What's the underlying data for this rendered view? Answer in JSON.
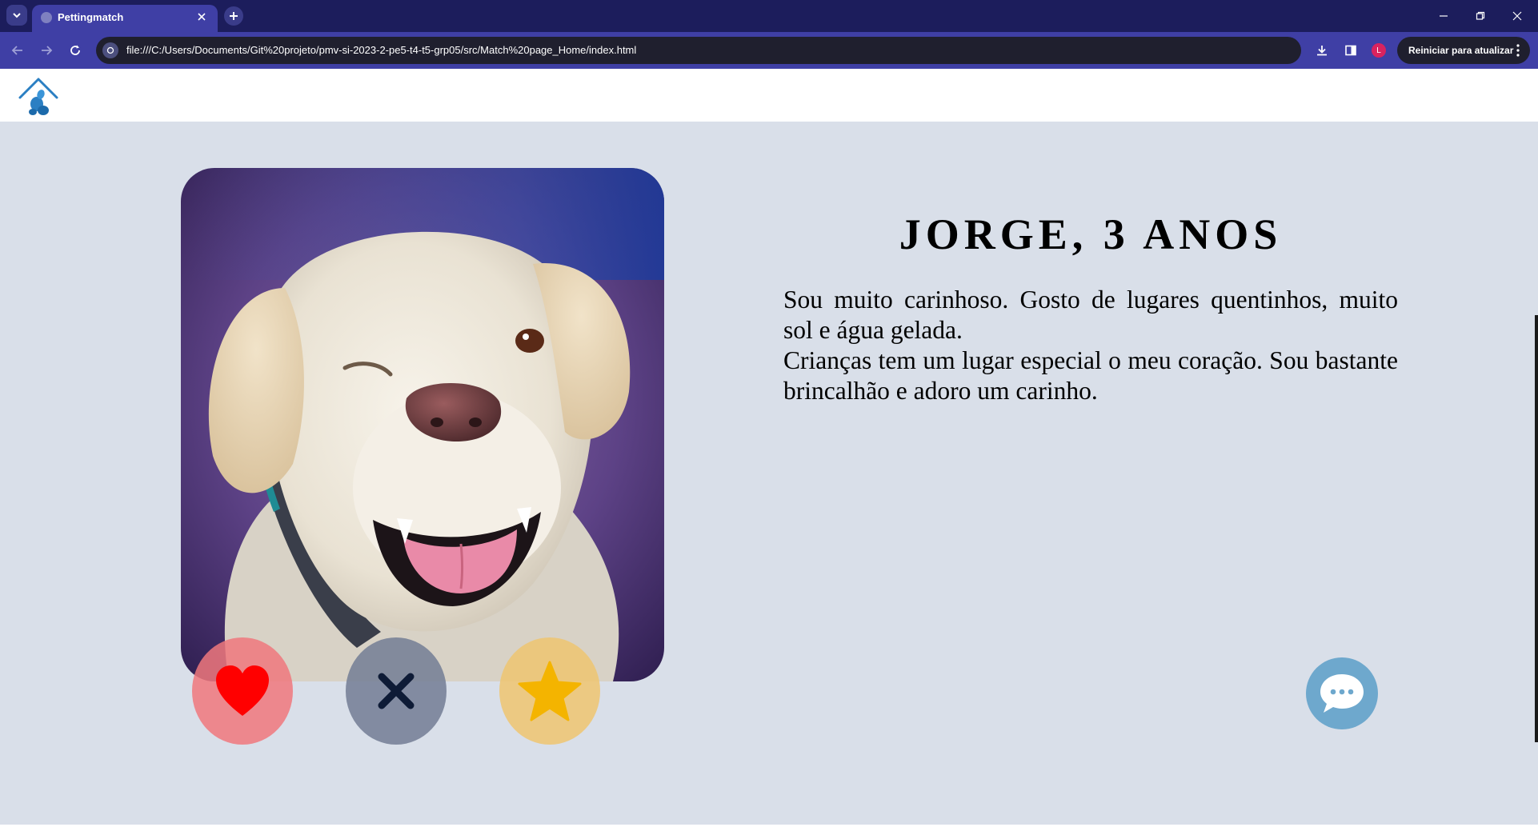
{
  "browser": {
    "tab_title": "Pettingmatch",
    "url": "file:///C:/Users/Documents/Git%20projeto/pmv-si-2023-2-pe5-t4-t5-grp05/src/Match%20page_Home/index.html",
    "profile_initial": "L",
    "update_button_label": "Reiniciar para atualizar"
  },
  "site": {
    "logo": "house-paw-logo-icon"
  },
  "profile": {
    "name_age": "JORGE, 3 ANOS",
    "bio_line1": "Sou muito carinhoso. Gosto de lugares quentinhos, muito sol e água gelada.",
    "bio_line2": "Crianças tem um lugar especial o meu coração. Sou bastante brincalhão e adoro um carinho.",
    "photo": "winking-labrador-photo"
  },
  "actions": {
    "like_icon": "heart-icon",
    "dislike_icon": "x-icon",
    "superlike_icon": "star-icon",
    "chat_icon": "chat-bubble-icon"
  },
  "colors": {
    "page_bg": "#d9dfe9",
    "like": "#f0787d",
    "dislike": "#757f96",
    "superlike": "#eec670",
    "chat": "#6ea8cd",
    "browser_frame": "#1c1d5c",
    "browser_toolbar": "#3f3fa5"
  }
}
